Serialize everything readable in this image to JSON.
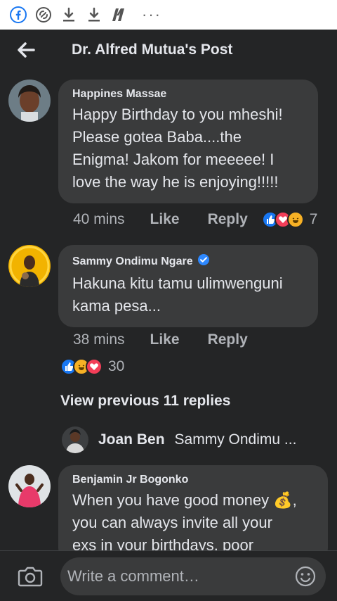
{
  "status_bar": {
    "icons": [
      "facebook-icon",
      "vpn-swirl-icon",
      "download-icon",
      "download-icon",
      "netflix-icon"
    ],
    "more": "···"
  },
  "header": {
    "title": "Dr. Alfred Mutua's Post",
    "back_icon": "arrow-left-icon"
  },
  "comments": [
    {
      "author": "Happines Massae",
      "verified": false,
      "lines": [
        "Happy Birthday to you mheshi!",
        "Please gotea Baba....the",
        "Enigma! Jakom for meeeee! I",
        "love the way he is enjoying!!!!!"
      ],
      "time": "40 mins",
      "like": "Like",
      "reply": "Reply",
      "reactions": [
        "like",
        "love",
        "haha"
      ],
      "reaction_count": "7"
    },
    {
      "author": "Sammy Ondimu Ngare",
      "verified": true,
      "lines": [
        "Hakuna kitu tamu ulimwenguni",
        "kama pesa..."
      ],
      "time": "38 mins",
      "like": "Like",
      "reply": "Reply",
      "reactions": [
        "like",
        "haha",
        "love"
      ],
      "reaction_count": "30"
    },
    {
      "author": "Benjamin Jr Bogonko",
      "verified": false,
      "lines": [
        "When you have good money 💰,",
        "you can always invite all your",
        "exs in your birthdays, poor"
      ]
    }
  ],
  "view_previous": "View previous 11 replies",
  "reply_preview": {
    "name": "Joan Ben",
    "snippet": "Sammy Ondimu ..."
  },
  "composer": {
    "placeholder": "Write a comment…",
    "camera_icon": "camera-icon",
    "emoji_icon": "smiley-icon"
  },
  "colors": {
    "background": "#242526",
    "bubble": "#3a3b3c",
    "text": "#e4e6eb",
    "muted": "#b0b3b8",
    "facebook_blue": "#1877f2",
    "verified_blue": "#2d88ff"
  }
}
